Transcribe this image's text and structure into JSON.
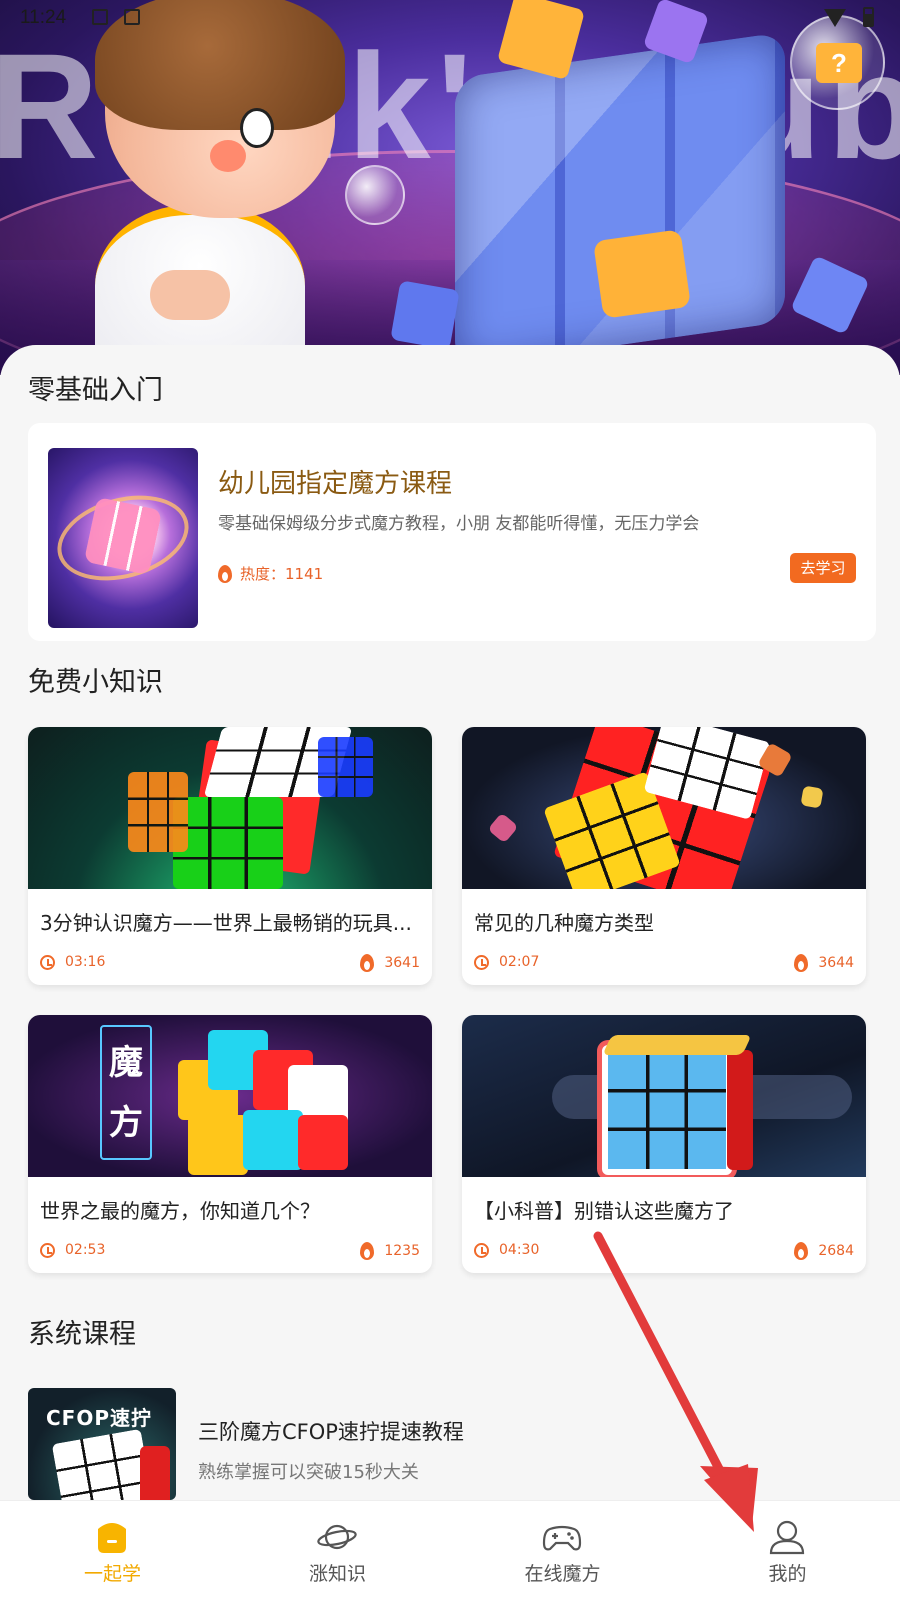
{
  "status_bar": {
    "time": "11:24"
  },
  "hero": {
    "title_text": "Rubik's Cube",
    "bubble_text": "?"
  },
  "sections": {
    "beginner": "零基础入门",
    "free_tips": "免费小知识",
    "system": "系统课程"
  },
  "featured_course": {
    "title": "幼儿园指定魔方课程",
    "description": "零基础保姆级分步式魔方教程，小朋 友都能听得懂，无压力学会",
    "heat": "热度：1141",
    "button": "去学习"
  },
  "videos": [
    {
      "title": "3分钟认识魔方——世界上最畅销的玩具...",
      "duration": "03:16",
      "views": "3641"
    },
    {
      "title": "常见的几种魔方类型",
      "duration": "02:07",
      "views": "3644"
    },
    {
      "title": "世界之最的魔方，你知道几个？",
      "duration": "02:53",
      "views": "1235"
    },
    {
      "title": "【小科普】别错认这些魔方了",
      "duration": "04:30",
      "views": "2684"
    }
  ],
  "video_3_badge": [
    "魔",
    "方"
  ],
  "system_course": {
    "thumb_label": "CFOP速拧",
    "title": "三阶魔方CFOP速拧提速教程",
    "description": "熟练掌握可以突破15秒大关"
  },
  "tabs": [
    {
      "label": "一起学",
      "icon": "study-icon",
      "active": true
    },
    {
      "label": "涨知识",
      "icon": "planet-icon",
      "active": false
    },
    {
      "label": "在线魔方",
      "icon": "gamepad-icon",
      "active": false
    },
    {
      "label": "我的",
      "icon": "user-icon",
      "active": false
    }
  ],
  "colors": {
    "accent": "#f26a20",
    "tab_active": "#f2a900",
    "annotation": "#e23b3b"
  }
}
